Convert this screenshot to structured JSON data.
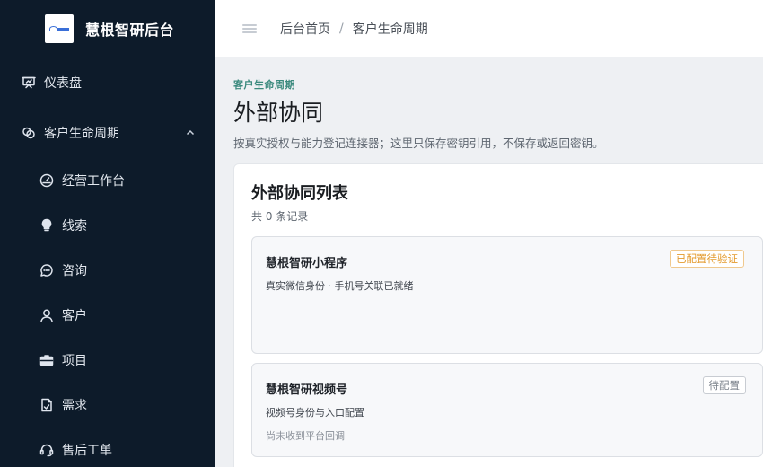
{
  "brand": {
    "title": "慧根智研后台",
    "logo_icon": "brand-logo"
  },
  "sidebar": {
    "items": [
      {
        "label": "仪表盘",
        "icon": "dashboard-icon",
        "level": "top"
      },
      {
        "label": "客户生命周期",
        "icon": "lifecycle-icon",
        "level": "top",
        "expanded": true
      },
      {
        "label": "经营工作台",
        "icon": "gauge-icon",
        "level": "sub"
      },
      {
        "label": "线索",
        "icon": "lightbulb-icon",
        "level": "sub"
      },
      {
        "label": "咨询",
        "icon": "chat-icon",
        "level": "sub"
      },
      {
        "label": "客户",
        "icon": "user-icon",
        "level": "sub"
      },
      {
        "label": "项目",
        "icon": "briefcase-icon",
        "level": "sub"
      },
      {
        "label": "需求",
        "icon": "document-icon",
        "level": "sub"
      },
      {
        "label": "售后工单",
        "icon": "headset-icon",
        "level": "sub"
      }
    ]
  },
  "header": {
    "menu_icon": "hamburger-icon",
    "breadcrumb": [
      "后台首页",
      "客户生命周期"
    ],
    "separator": "/"
  },
  "page": {
    "eyebrow": "客户生命周期",
    "title": "外部协同",
    "description": "按真实授权与能力登记连接器；这里只保存密钥引用，不保存或返回密钥。"
  },
  "list": {
    "title": "外部协同列表",
    "count_text": "共 0 条记录",
    "connectors": [
      {
        "name": "慧根智研小程序",
        "description": "真实微信身份 · 手机号关联已就绪",
        "note": "",
        "status": "已配置待验证"
      },
      {
        "name": "慧根智研视频号",
        "description": "视频号身份与入口配置",
        "note": "尚未收到平台回调",
        "status": "待配置"
      }
    ]
  },
  "colors": {
    "sidebar_bg": "#0d1b2a",
    "accent_teal": "#3b8a7e",
    "status_warn": "#e39a2d",
    "status_idle": "#7b828b"
  }
}
